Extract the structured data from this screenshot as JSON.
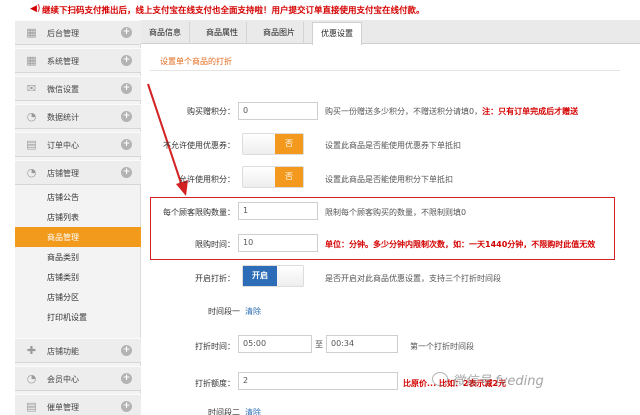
{
  "notice": {
    "text": "继续下扫码支付推出后，线上支付宝在线支付也全面支持啦！用户提交订单直接使用支付宝在线付款。"
  },
  "sidebar": {
    "items": [
      {
        "label": "后台管理",
        "icon": "grid-icon"
      },
      {
        "label": "系统管理",
        "icon": "grid-icon"
      },
      {
        "label": "微信设置",
        "icon": "mail-icon"
      },
      {
        "label": "数据统计",
        "icon": "pie-icon"
      },
      {
        "label": "订单中心",
        "icon": "printer-icon"
      },
      {
        "label": "店铺管理",
        "icon": "pie-icon"
      }
    ],
    "sub_items": [
      {
        "label": "店铺公告"
      },
      {
        "label": "店铺列表"
      },
      {
        "label": "商品管理"
      },
      {
        "label": "商品类别"
      },
      {
        "label": "店铺类别"
      },
      {
        "label": "店铺分区"
      },
      {
        "label": "打印机设置"
      }
    ],
    "bottom_items": [
      {
        "label": "店铺功能",
        "icon": "plus-icon"
      },
      {
        "label": "会员中心",
        "icon": "pie-icon"
      },
      {
        "label": "催单管理",
        "icon": "printer-icon"
      }
    ]
  },
  "tabs": [
    "商品信息",
    "商品属性",
    "商品图片",
    "优惠设置"
  ],
  "section_title": "设置单个商品的打折",
  "form": {
    "points": {
      "label": "购买赠积分：",
      "value": "0",
      "hint": "购买一份赠送多少积分，不赠送积分请填0，",
      "hint_red": "注：只有订单完成后才赠送"
    },
    "coupon": {
      "label": "不允许使用优惠券：",
      "toggle": "否",
      "hint": "设置此商品是否能使用优惠券下单抵扣"
    },
    "use_points": {
      "label": "允许使用积分：",
      "toggle": "否",
      "hint": "设置此商品是否能使用积分下单抵扣"
    },
    "limit_qty": {
      "label": "每个顾客限购数量：",
      "value": "1",
      "hint": "限制每个顾客购买的数量，不限制则填0"
    },
    "limit_time": {
      "label": "限购时间：",
      "value": "10",
      "hint_red": "单位：分钟。多少分钟内限制次数，如：一天1440分钟，不限购时此值无效"
    },
    "discount": {
      "label": "开启打折：",
      "toggle": "开启",
      "hint": "是否开启对此商品优惠设置，支持三个打折时间段"
    },
    "period1": {
      "label": "时间段一",
      "clear": "清除"
    },
    "discount_time": {
      "label": "打折时间：",
      "start": "05:00",
      "sep": "至",
      "end": "00:34",
      "hint": "第一个打折时间段"
    },
    "discount_amount": {
      "label": "打折额度：",
      "value": "2",
      "hint_red": "比原价... 比如：2表示减2元"
    },
    "period2": {
      "label": "时间段二",
      "clear": "清除"
    }
  },
  "watermark": "微信号 fveding",
  "colors": {
    "accent": "#f19a1b",
    "toggle_on": "#2d6db7",
    "alert": "#d40000"
  }
}
